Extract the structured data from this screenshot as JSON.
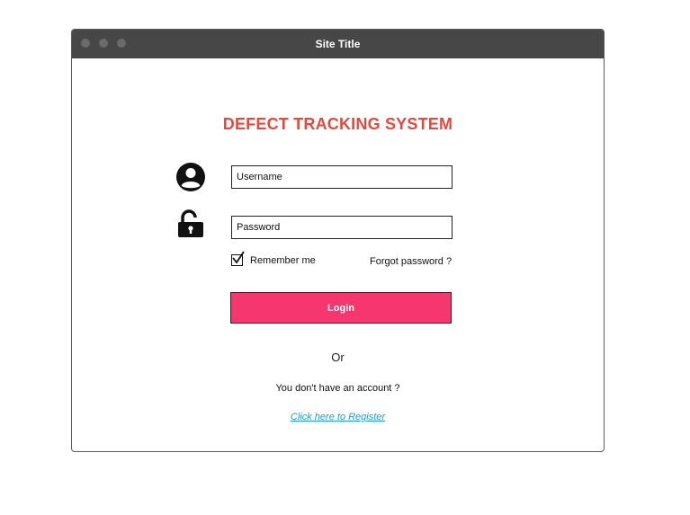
{
  "window": {
    "title": "Site Title"
  },
  "heading": "DEFECT TRACKING SYSTEM",
  "form": {
    "username_placeholder": "Username",
    "password_placeholder": "Password",
    "remember_label": "Remember me",
    "remember_checked": true,
    "forgot_label": "Forgot password ?",
    "login_label": "Login"
  },
  "footer": {
    "or_text": "Or",
    "no_account_text": "You don't have an account ?",
    "register_link": "Click here to Register"
  },
  "colors": {
    "heading": "#e8483c",
    "login_button": "#f6376f",
    "link": "#1a9fd6",
    "titlebar": "#474747"
  },
  "icons": {
    "user": "user-circle-icon",
    "password": "unlock-icon",
    "checkbox": "checkmark-icon"
  }
}
